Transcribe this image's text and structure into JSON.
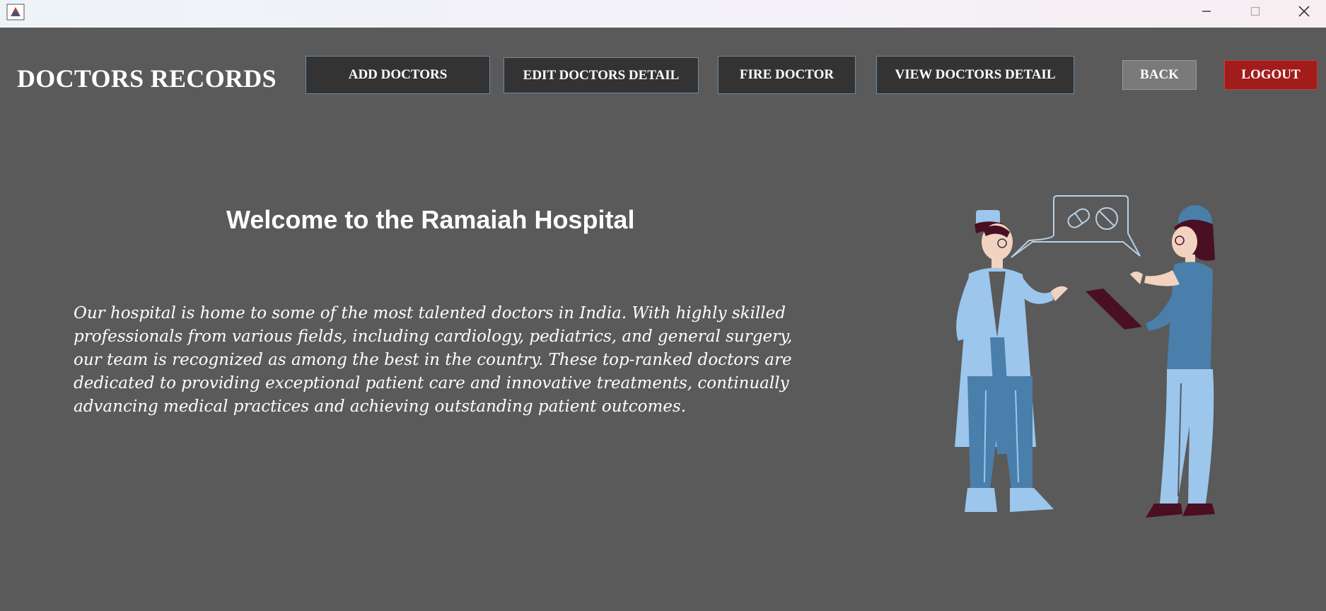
{
  "window": {
    "icon": "java-app-icon",
    "controls": [
      "minimize-icon",
      "maximize-icon",
      "close-icon"
    ]
  },
  "header": {
    "title": "DOCTORS RECORDS",
    "buttons": {
      "add": "ADD DOCTORS",
      "edit": "EDIT DOCTORS DETAIL",
      "fire": "FIRE DOCTOR",
      "view": "VIEW DOCTORS DETAIL",
      "back": "BACK",
      "logout": "LOGOUT"
    }
  },
  "main": {
    "welcome": "Welcome to the Ramaiah Hospital",
    "description": "Our hospital is home to some of the most talented doctors in India. With highly skilled professionals from various fields, including cardiology, pediatrics, and general surgery, our team is recognized as among the best in the country. These top-ranked doctors are dedicated to providing exceptional patient care and innovative treatments, continually advancing medical practices and achieving outstanding patient outcomes.",
    "illustration": "doctors-conversation-illustration"
  },
  "colors": {
    "background": "#5a5a5a",
    "button_dark": "#333333",
    "button_back": "#7a7a7a",
    "button_logout": "#a31c1c",
    "illustration_light_blue": "#9cc6ec",
    "illustration_mid_blue": "#4a7eab",
    "illustration_dark": "#4a0f22"
  }
}
